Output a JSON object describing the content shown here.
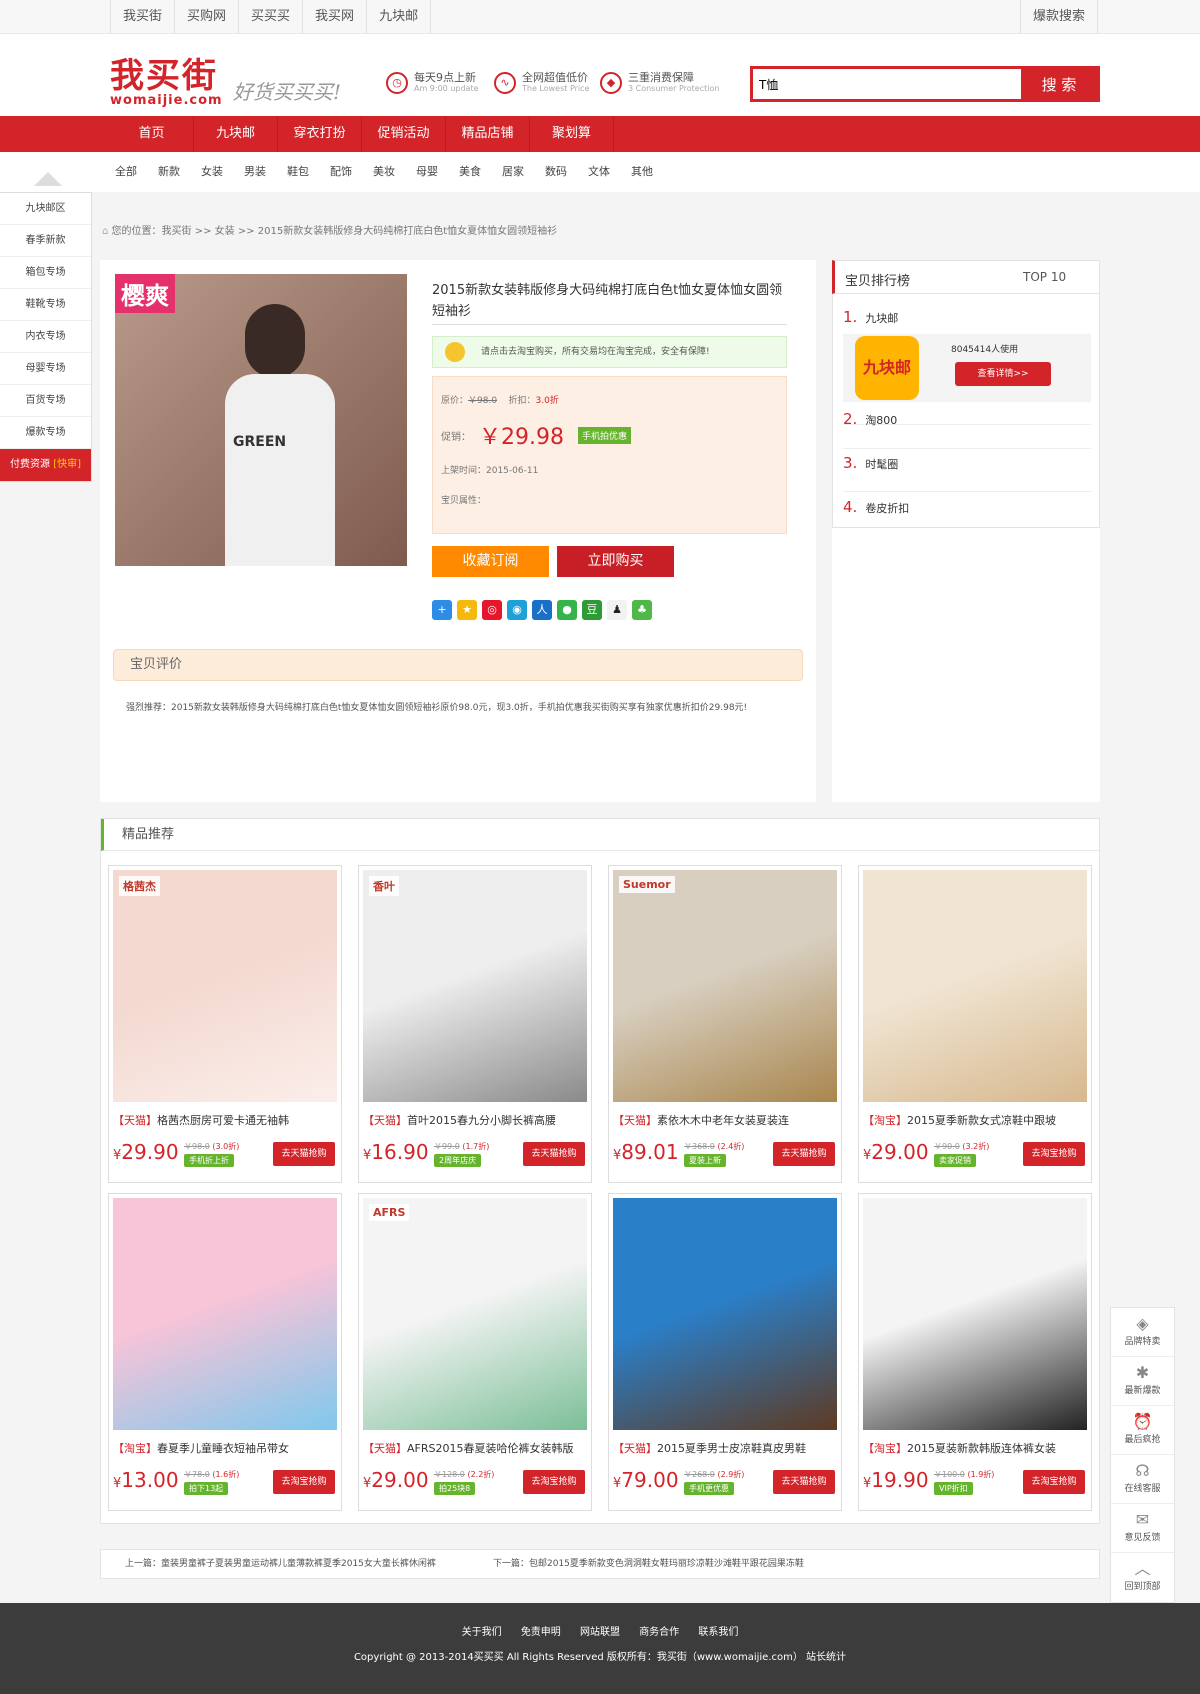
{
  "topbar": {
    "links": [
      "我买街",
      "买购网",
      "买买买",
      "我买网",
      "九块邮"
    ],
    "hot": "爆款搜索"
  },
  "header": {
    "logo_cn": "我买街",
    "logo_en": "womaijie.com",
    "slogan": "好货买买买!",
    "features": [
      {
        "t1": "每天9点上新",
        "t2": "Am 9:00 update"
      },
      {
        "t1": "全网超值低价",
        "t2": "The Lowest Price"
      },
      {
        "t1": "三重消费保障",
        "t2": "3 Consumer Protection"
      }
    ],
    "search_value": "T恤",
    "search_button": "搜 索"
  },
  "nav": [
    "首页",
    "九块邮",
    "穿衣打扮",
    "促销活动",
    "精品店铺",
    "聚划算"
  ],
  "subnav": [
    "全部",
    "新款",
    "女装",
    "男装",
    "鞋包",
    "配饰",
    "美妆",
    "母婴",
    "美食",
    "居家",
    "数码",
    "文体",
    "其他"
  ],
  "leftmenu": {
    "items": [
      "九块邮区",
      "春季新款",
      "箱包专场",
      "鞋靴专场",
      "内衣专场",
      "母婴专场",
      "百货专场",
      "爆款专场"
    ],
    "paid": "付费资源",
    "paid_em": "[快审]"
  },
  "breadcrumb": "您的位置：我买街 >> 女装 >> 2015新款女装韩版修身大码纯棉打底白色t恤女夏体恤女圆领短袖衫",
  "product": {
    "image_tag": "樱爽",
    "image_text": "GREEN",
    "title": "2015新款女装韩版修身大码纯棉打底白色t恤女夏体恤女圆领短袖衫",
    "notice": "请点击去淘宝购买，所有交易均在淘宝完成，安全有保障!",
    "orig_label": "原价：",
    "orig_price": "￥98.0",
    "disc_label": "折扣：",
    "discount": "3.0折",
    "promo_label": "促销：",
    "price": "￥29.98",
    "mobile_badge": "手机拍优惠",
    "date": "上架时间：2015-06-11",
    "attr": "宝贝属性：",
    "btn_sub": "收藏订阅",
    "btn_buy": "立即购买",
    "share_icons": [
      "plus-share-icon",
      "qzone-share-icon",
      "weibo-share-icon",
      "tqq-share-icon",
      "renren-share-icon",
      "wechat-share-icon",
      "douban-share-icon",
      "qq-share-icon",
      "clover-share-icon"
    ],
    "review_title": "宝贝评价",
    "review_text": "强烈推荐：2015新款女装韩版修身大码纯棉打底白色t恤女夏体恤女圆领短袖衫原价98.0元，现3.0折，手机拍优惠我买街购买享有独家优惠折扣价29.98元!"
  },
  "rank": {
    "title": "宝贝排行榜",
    "top": "TOP 10",
    "items": [
      {
        "n": "1.",
        "name": "九块邮"
      },
      {
        "n": "2.",
        "name": "淘800"
      },
      {
        "n": "3.",
        "name": "时髦圈"
      },
      {
        "n": "4.",
        "name": "卷皮折扣"
      }
    ],
    "first_icon": "九块邮",
    "first_users": "8045414人使用",
    "first_detail": "查看详情>>"
  },
  "rec": {
    "title": "精品推荐",
    "cards": [
      {
        "label": "格茜杰",
        "src": "【天猫】",
        "name": "格茜杰厨房可爱卡通无袖韩",
        "price": "29.90",
        "old": "￥98.0",
        "disc": "(3.0折)",
        "tag": "手机折上折",
        "go": "去天猫抢购",
        "c1": "#f3d9d0",
        "c2": "#fbeeea"
      },
      {
        "label": "香叶",
        "src": "【天猫】",
        "name": "首叶2015春九分小脚长裤高腰",
        "price": "16.90",
        "old": "￥99.0",
        "disc": "(1.7折)",
        "tag": "2周年店庆",
        "go": "去天猫抢购",
        "c1": "#eeeeee",
        "c2": "#8a8a8a"
      },
      {
        "label": "Suemor",
        "src": "【天猫】",
        "name": "素依木木中老年女装夏装连",
        "price": "89.01",
        "old": "￥368.0",
        "disc": "(2.4折)",
        "tag": "夏装上新",
        "go": "去天猫抢购",
        "c1": "#d8cfc0",
        "c2": "#a9864e"
      },
      {
        "label": "",
        "src": "【淘宝】",
        "name": "2015夏季新款女式凉鞋中跟坡",
        "price": "29.00",
        "old": "￥90.0",
        "disc": "(3.2折)",
        "tag": "卖家促销",
        "go": "去淘宝抢购",
        "c1": "#f0e5d3",
        "c2": "#d7b88e"
      },
      {
        "label": "",
        "src": "【淘宝】",
        "name": "春夏季儿童睡衣短袖吊带女",
        "price": "13.00",
        "old": "￥78.0",
        "disc": "(1.6折)",
        "tag": "拍下13起",
        "go": "去淘宝抢购",
        "c1": "#f8c4d8",
        "c2": "#7fc8ec"
      },
      {
        "label": "AFRS",
        "src": "【天猫】",
        "name": "AFRS2015春夏装哈伦裤女装韩版",
        "price": "29.00",
        "old": "￥128.0",
        "disc": "(2.2折)",
        "tag": "拍25块8",
        "go": "去淘宝抢购",
        "c1": "#f4f4f4",
        "c2": "#7cbf98"
      },
      {
        "label": "",
        "src": "【天猫】",
        "name": "2015夏季男士皮凉鞋真皮男鞋",
        "price": "79.00",
        "old": "￥268.0",
        "disc": "(2.9折)",
        "tag": "手机更优惠",
        "go": "去天猫抢购",
        "c1": "#2a7fc9",
        "c2": "#5e3a22"
      },
      {
        "label": "",
        "src": "【淘宝】",
        "name": "2015夏装新款韩版连体裤女装",
        "price": "19.90",
        "old": "￥100.0",
        "disc": "(1.9折)",
        "tag": "VIP折扣",
        "go": "去淘宝抢购",
        "c1": "#f4f4f4",
        "c2": "#222222"
      }
    ]
  },
  "prevnext": {
    "prev": "上一篇：童装男童裤子夏装男童运动裤儿童薄款裤夏季2015女大童长裤休闲裤",
    "next": "下一篇：包邮2015夏季新款变色洞洞鞋女鞋玛丽珍凉鞋沙滩鞋平跟花园果冻鞋"
  },
  "footer": {
    "links": [
      "关于我们",
      "免责申明",
      "网站联盟",
      "商务合作",
      "联系我们"
    ],
    "copyright": "Copyright @ 2013-2014买买买 All Rights Reserved 版权所有：我买街（www.womaijie.com） 站长统计"
  },
  "sidebar": [
    {
      "icon": "brand-tag-icon",
      "g": "◈",
      "label": "品牌特卖"
    },
    {
      "icon": "new-badge-icon",
      "g": "✱",
      "label": "最新爆款"
    },
    {
      "icon": "alarm-clock-icon",
      "g": "⏰",
      "label": "最后疯抢"
    },
    {
      "icon": "headset-icon",
      "g": "☊",
      "label": "在线客服"
    },
    {
      "icon": "feedback-bubble-icon",
      "g": "✉",
      "label": "意见反馈"
    },
    {
      "icon": "chevron-up-icon",
      "g": "︿",
      "label": "回到顶部"
    }
  ]
}
